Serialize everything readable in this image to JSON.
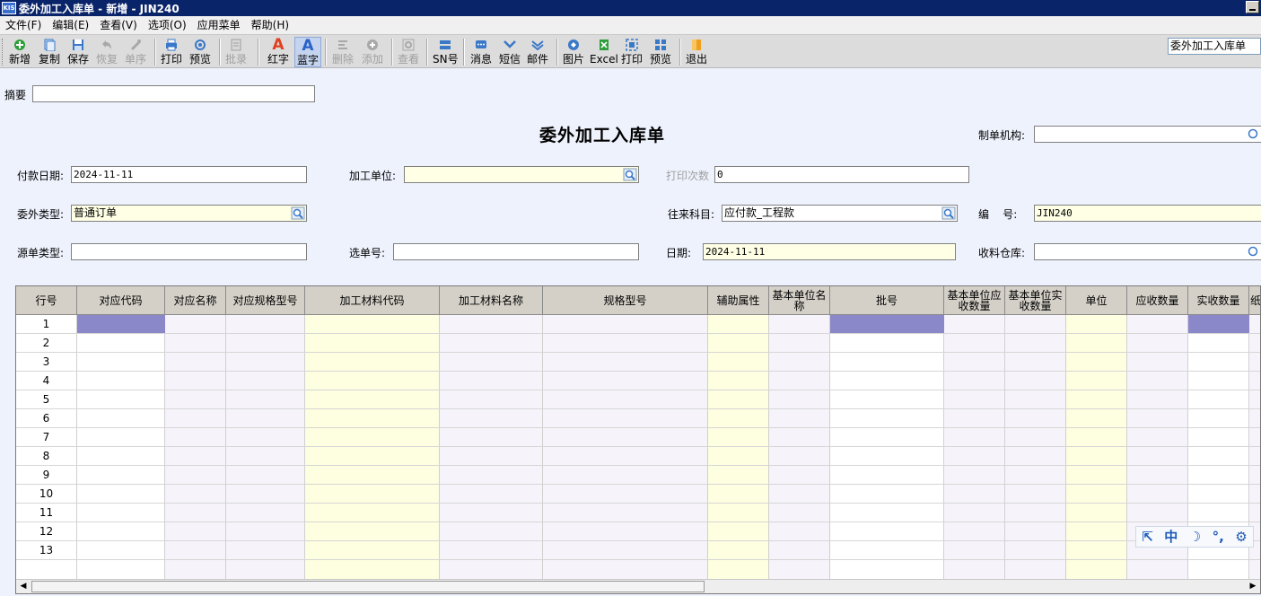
{
  "window": {
    "app_icon_text": "KIS",
    "title": "委外加工入库单 - 新增 - JIN240"
  },
  "menu": [
    "文件(F)",
    "编辑(E)",
    "查看(V)",
    "选项(O)",
    "应用菜单",
    "帮助(H)"
  ],
  "toolbar": {
    "buttons": [
      {
        "label": "新增",
        "icon": "new-icon",
        "color": "#2e9e3a"
      },
      {
        "label": "复制",
        "icon": "copy-icon",
        "color": "#3a78c8"
      },
      {
        "label": "保存",
        "icon": "save-icon",
        "color": "#3a78c8"
      },
      {
        "label": "恢复",
        "icon": "undo-icon",
        "color": "#a0a0a0"
      },
      {
        "label": "单序",
        "icon": "sequence-icon",
        "color": "#a0a0a0"
      },
      {
        "label": "打印",
        "icon": "print-icon",
        "color": "#3a78c8"
      },
      {
        "label": "预览",
        "icon": "preview-icon",
        "color": "#3a78c8"
      },
      {
        "label": "批录",
        "icon": "batch-entry-icon",
        "color": "#a0a0a0"
      },
      {
        "label": "红字",
        "icon": "red-letter-icon",
        "color": "#e04020"
      },
      {
        "label": "蓝字",
        "icon": "blue-letter-icon",
        "color": "#2a62c8"
      },
      {
        "label": "删除",
        "icon": "delete-row-icon",
        "color": "#a0a0a0"
      },
      {
        "label": "添加",
        "icon": "add-row-icon",
        "color": "#a0a0a0"
      },
      {
        "label": "查看",
        "icon": "view-icon",
        "color": "#a0a0a0"
      },
      {
        "label": "SN号",
        "icon": "sn-icon",
        "color": "#3a78c8"
      },
      {
        "label": "消息",
        "icon": "message-icon",
        "color": "#3a78c8"
      },
      {
        "label": "短信",
        "icon": "sms-icon",
        "color": "#3a78c8"
      },
      {
        "label": "邮件",
        "icon": "mail-icon",
        "color": "#3a78c8"
      },
      {
        "label": "图片",
        "icon": "picture-icon",
        "color": "#3a78c8"
      },
      {
        "label": "Excel",
        "icon": "excel-icon",
        "color": "#2e9e3a"
      },
      {
        "label": "打印",
        "icon": "print-icon",
        "color": "#3a78c8"
      },
      {
        "label": "预览",
        "icon": "preview-icon",
        "color": "#3a78c8"
      },
      {
        "label": "退出",
        "icon": "exit-icon",
        "color": "#f0a020"
      }
    ],
    "title_box": "委外加工入库单"
  },
  "form": {
    "summary_label": "摘要",
    "summary_value": "",
    "title": "委外加工入库单",
    "org_label": "制单机构:",
    "org_value": "",
    "pay_date_label": "付款日期:",
    "pay_date_value": "2024-11-11",
    "processor_label": "加工单位:",
    "processor_value": "",
    "print_count_label": "打印次数",
    "print_count_value": "0",
    "outsource_type_label": "委外类型:",
    "outsource_type_value": "普通订单",
    "account_label": "往来科目:",
    "account_value": "应付款_工程款",
    "number_label": "编    号:",
    "number_value": "JIN240",
    "source_type_label": "源单类型:",
    "source_type_value": "",
    "select_no_label": "选单号:",
    "select_no_value": "",
    "date_label": "日期:",
    "date_value": "2024-11-11",
    "warehouse_label": "收料仓库:",
    "warehouse_value": ""
  },
  "grid": {
    "columns": [
      "行号",
      "对应代码",
      "对应名称",
      "对应规格型号",
      "加工材料代码",
      "加工材料名称",
      "规格型号",
      "辅助属性",
      "基本单位名称",
      "批号",
      "基本单位应收数量",
      "基本单位实收数量",
      "单位",
      "应收数量",
      "实收数量",
      "纸"
    ],
    "rows": [
      "1",
      "2",
      "3",
      "4",
      "5",
      "6",
      "7",
      "8",
      "9",
      "10",
      "11",
      "12",
      "13"
    ],
    "colors": {
      "header_bg": "#d4d0c8",
      "selected": "#8a88c8",
      "yellow_col": "#fefee0",
      "lavender_col": "#f6f4fa"
    }
  },
  "ime": {
    "icon1": "⇱",
    "mode": "中",
    "moon": "☽",
    "punct": "°,",
    "gear": "⚙"
  }
}
